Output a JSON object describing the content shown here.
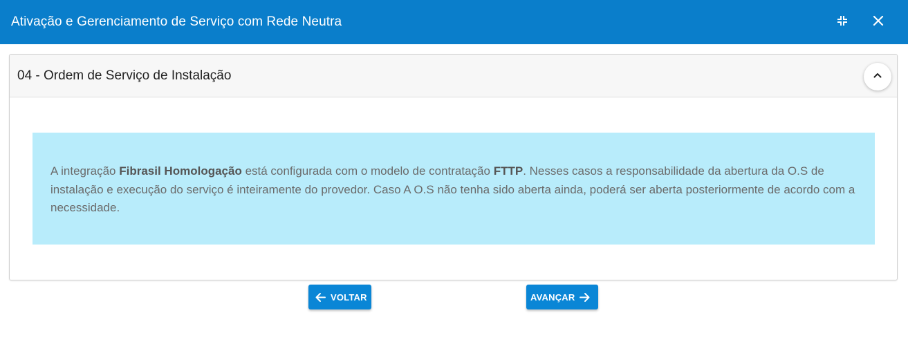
{
  "window": {
    "title": "Ativação e Gerenciamento de Serviço com Rede Neutra",
    "minimize_icon": "minimize-arrows-icon",
    "close_icon": "close-icon",
    "bar_color": "#0a7ecb"
  },
  "section": {
    "title": "04 - Ordem de Serviço de Instalação",
    "toggle_icon": "chevron-up-icon"
  },
  "info": {
    "text_before_integration": "A integração ",
    "integration_name": "Fibrasil Homologação",
    "text_before_model": " está configurada com o modelo de contratação ",
    "model": "FTTP",
    "text_after_model": ". Nesses casos a responsabilidade da abertura da O.S de instalação e execução do serviço é inteiramente do provedor. Caso A O.S não tenha sido aberta ainda, poderá ser aberta posteriormente de acordo com a necessidade.",
    "background_color": "#b8ecfb"
  },
  "navigation": {
    "back_label": "VOLTAR",
    "back_icon": "arrow-left-icon",
    "next_label": "AVANÇAR",
    "next_icon": "arrow-right-icon",
    "button_color": "#0a86d6"
  }
}
